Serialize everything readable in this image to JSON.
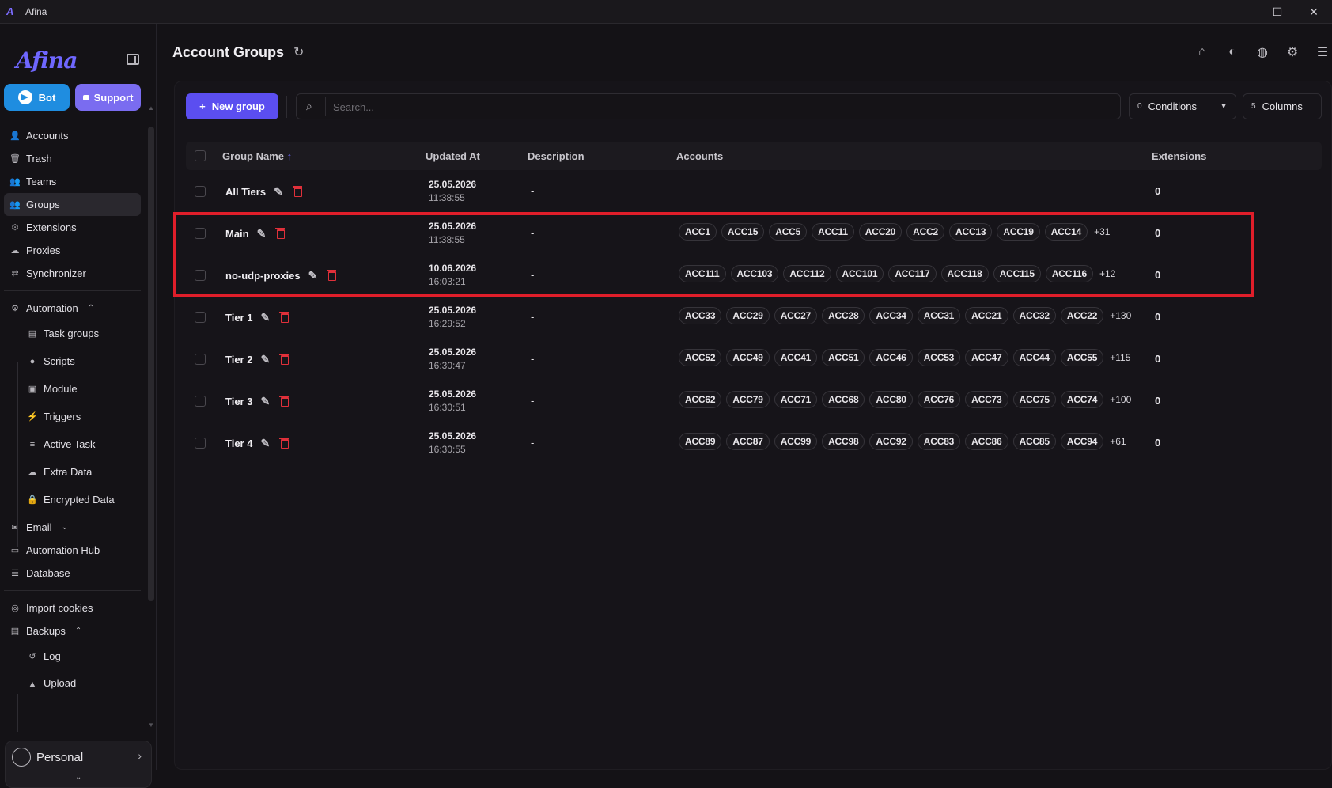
{
  "window": {
    "app_logo": "A",
    "title": "Afina",
    "controls": [
      "—",
      "☐",
      "✕"
    ]
  },
  "sidebar": {
    "logo": "Afina",
    "bot_label": "Bot",
    "support_label": "Support",
    "items": [
      {
        "label": "Accounts",
        "icon": "👤"
      },
      {
        "label": "Trash",
        "icon": "🗑"
      },
      {
        "label": "Teams",
        "icon": "👥"
      },
      {
        "label": "Groups",
        "icon": "👥"
      },
      {
        "label": "Extensions",
        "icon": "⚙"
      },
      {
        "label": "Proxies",
        "icon": "☁"
      },
      {
        "label": "Synchronizer",
        "icon": "⇄"
      }
    ],
    "automation": {
      "label": "Automation",
      "children": [
        "Task groups",
        "Scripts",
        "Module",
        "Triggers",
        "Active Task",
        "Extra Data",
        "Encrypted Data"
      ]
    },
    "email_label": "Email",
    "automation_hub_label": "Automation Hub",
    "database_label": "Database",
    "import_cookies_label": "Import cookies",
    "backups": {
      "label": "Backups",
      "children": [
        "Log",
        "Upload"
      ]
    },
    "profile": {
      "name": "Personal"
    }
  },
  "main": {
    "title": "Account Groups",
    "new_group_label": "New group",
    "search_placeholder": "Search...",
    "conditions": {
      "count": "0",
      "label": "Conditions"
    },
    "columns": {
      "count": "5",
      "label": "Columns"
    },
    "headers": {
      "name": "Group Name",
      "updated": "Updated At",
      "description": "Description",
      "accounts": "Accounts",
      "extensions": "Extensions"
    },
    "rows": [
      {
        "name": "All Tiers",
        "date": "25.05.2026",
        "time": "11:38:55",
        "description": "-",
        "accounts": [],
        "more": "",
        "extensions": "0"
      },
      {
        "name": "Main",
        "date": "25.05.2026",
        "time": "11:38:55",
        "description": "-",
        "accounts": [
          "ACC1",
          "ACC15",
          "ACC5",
          "ACC11",
          "ACC20",
          "ACC2",
          "ACC13",
          "ACC19",
          "ACC14"
        ],
        "more": "+31",
        "extensions": "0"
      },
      {
        "name": "no-udp-proxies",
        "date": "10.06.2026",
        "time": "16:03:21",
        "description": "-",
        "accounts": [
          "ACC111",
          "ACC103",
          "ACC112",
          "ACC101",
          "ACC117",
          "ACC118",
          "ACC115",
          "ACC116"
        ],
        "more": "+12",
        "extensions": "0"
      },
      {
        "name": "Tier 1",
        "date": "25.05.2026",
        "time": "16:29:52",
        "description": "-",
        "accounts": [
          "ACC33",
          "ACC29",
          "ACC27",
          "ACC28",
          "ACC34",
          "ACC31",
          "ACC21",
          "ACC32",
          "ACC22"
        ],
        "more": "+130",
        "extensions": "0"
      },
      {
        "name": "Tier 2",
        "date": "25.05.2026",
        "time": "16:30:47",
        "description": "-",
        "accounts": [
          "ACC52",
          "ACC49",
          "ACC41",
          "ACC51",
          "ACC46",
          "ACC53",
          "ACC47",
          "ACC44",
          "ACC55"
        ],
        "more": "+115",
        "extensions": "0"
      },
      {
        "name": "Tier 3",
        "date": "25.05.2026",
        "time": "16:30:51",
        "description": "-",
        "accounts": [
          "ACC62",
          "ACC79",
          "ACC71",
          "ACC68",
          "ACC80",
          "ACC76",
          "ACC73",
          "ACC75",
          "ACC74"
        ],
        "more": "+100",
        "extensions": "0"
      },
      {
        "name": "Tier 4",
        "date": "25.05.2026",
        "time": "16:30:55",
        "description": "-",
        "accounts": [
          "ACC89",
          "ACC87",
          "ACC99",
          "ACC98",
          "ACC92",
          "ACC83",
          "ACC86",
          "ACC85",
          "ACC94"
        ],
        "more": "+61",
        "extensions": "0"
      }
    ]
  },
  "colors": {
    "accent": "#5b4ef0",
    "danger": "#e0303a",
    "highlight": "#e01e2a",
    "bot": "#1f8de0",
    "support": "#7a6cf0"
  }
}
